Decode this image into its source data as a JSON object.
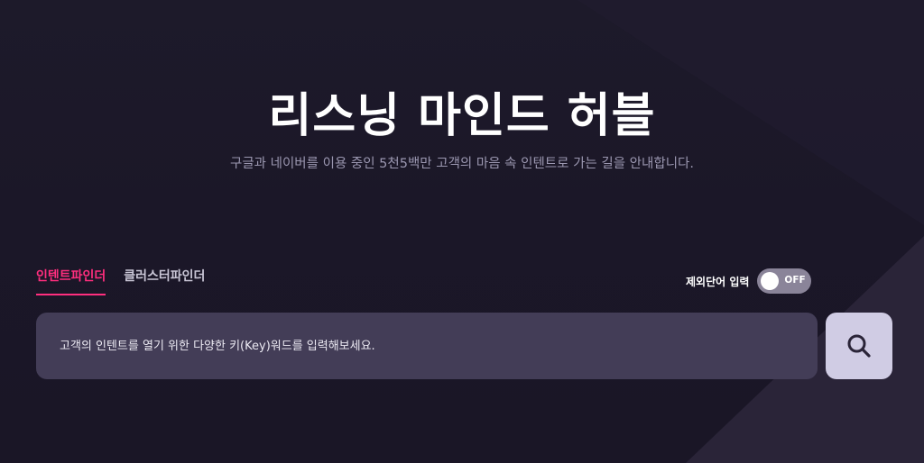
{
  "hero": {
    "title": "리스닝 마인드 허블",
    "subtitle": "구글과 네이버를 이용 중인 5천5백만 고객의 마음 속 인텐트로 가는 길을 안내합니다."
  },
  "tabs": [
    {
      "label": "인텐트파인더",
      "active": true
    },
    {
      "label": "클러스터파인더",
      "active": false
    }
  ],
  "exclude_words": {
    "label": "제외단어 입력",
    "toggle_state": "OFF"
  },
  "search": {
    "placeholder": "고객의 인텐트를 열기 위한 다양한 키(Key)워드를 입력해보세요.",
    "value": "",
    "button_icon": "search-icon"
  },
  "colors": {
    "background": "#1b1728",
    "accent": "#ff2e7e",
    "input_bg": "#433d57",
    "search_button_bg": "#d0cce4",
    "toggle_off_bg": "#8a8499"
  }
}
